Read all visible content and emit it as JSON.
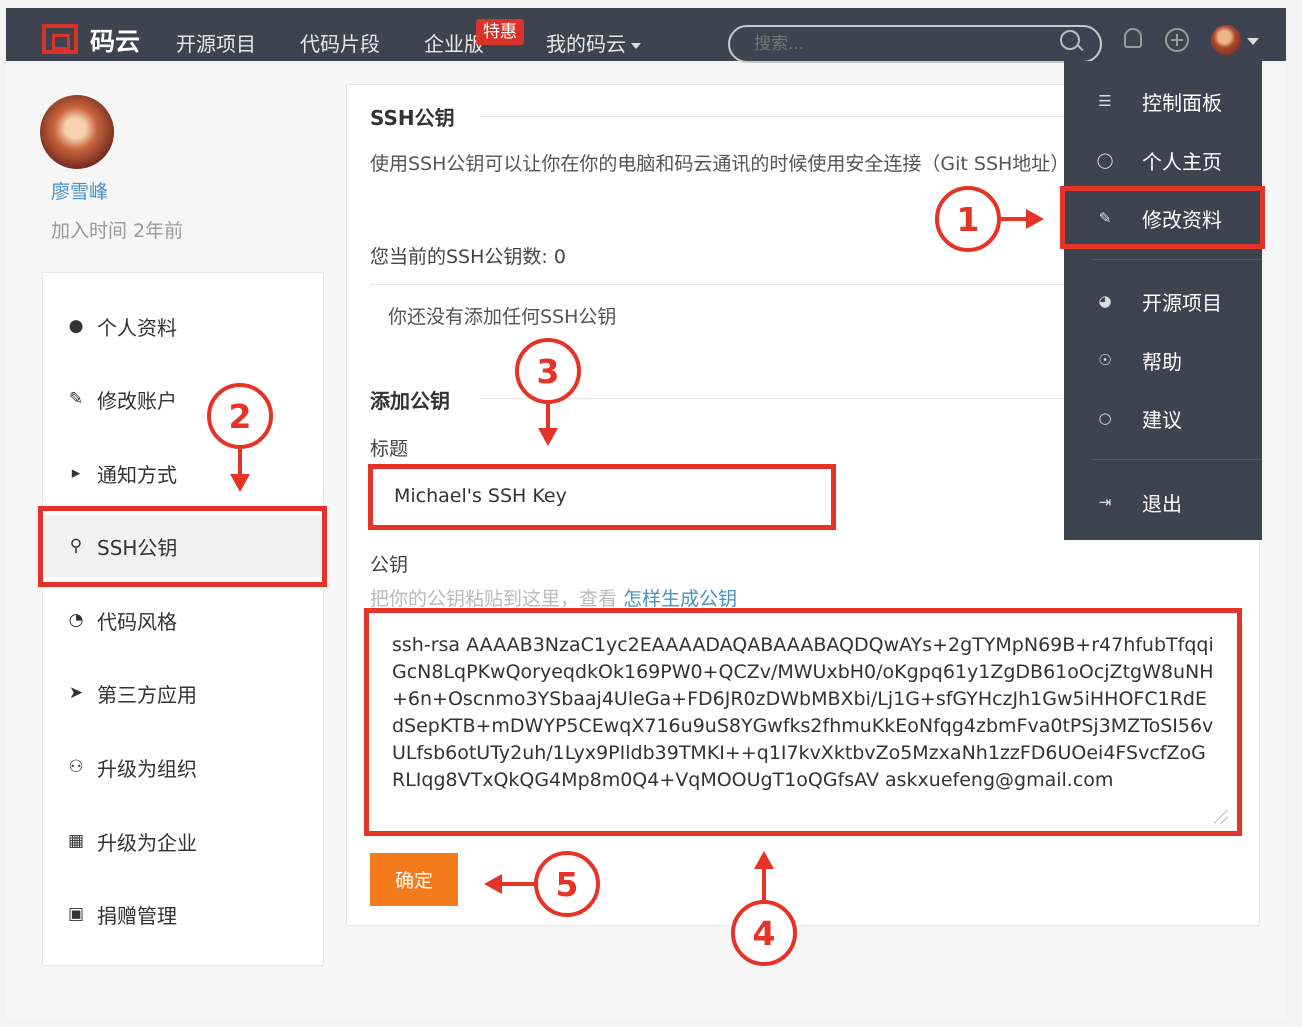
{
  "navbar": {
    "brand": "码云",
    "links": [
      "开源项目",
      "代码片段",
      "企业版",
      "我的码云"
    ],
    "hot_badge": "特惠",
    "search_placeholder": "搜索..."
  },
  "profile": {
    "name": "廖雪峰",
    "joined": "加入时间 2年前"
  },
  "sidebar": {
    "items": [
      {
        "label": "个人资料",
        "icon": "user-icon"
      },
      {
        "label": "修改账户",
        "icon": "pencil-icon"
      },
      {
        "label": "通知方式",
        "icon": "volume-icon"
      },
      {
        "label": "SSH公钥",
        "icon": "key-icon"
      },
      {
        "label": "代码风格",
        "icon": "dashboard-icon"
      },
      {
        "label": "第三方应用",
        "icon": "rocket-icon"
      },
      {
        "label": "升级为组织",
        "icon": "group-icon"
      },
      {
        "label": "升级为企业",
        "icon": "building-icon"
      },
      {
        "label": "捐赠管理",
        "icon": "gift-icon"
      }
    ]
  },
  "ssh": {
    "section_title": "SSH公钥",
    "description": "使用SSH公钥可以让你在你的电脑和码云通讯的时候使用安全连接（Git SSH地址）",
    "count_text": "您当前的SSH公钥数: 0",
    "empty_text": "你还没有添加任何SSH公钥"
  },
  "add_key": {
    "section_title": "添加公钥",
    "title_label": "标题",
    "title_value": "Michael's SSH Key",
    "key_label": "公钥",
    "hint_prefix": "把你的公钥粘贴到这里，查看",
    "hint_link": "怎样生成公钥",
    "key_value": "ssh-rsa AAAAB3NzaC1yc2EAAAADAQABAAABAQDQwAYs+2gTYMpN69B+r47hfubTfqqiGcN8LqPKwQoryeqdkOk169PW0+QCZv/MWUxbH0/oKgpq61y1ZgDB61oOcjZtgW8uNH+6n+Oscnmo3YSbaaj4UleGa+FD6JR0zDWbMBXbi/Lj1G+sfGYHczJh1Gw5iHHOFC1RdEdSepKTB+mDWYP5CEwqX716u9uS8YGwfks2fhmuKkEoNfqg4zbmFva0tPSj3MZToSI56vULfsb6otUTy2uh/1Lyx9PIldb39TMKI++q1I7kvXktbvZo5MzxaNh1zzFD6UOei4FSvcfZoGRLIqg8VTxQkQG4Mp8m0Q4+VqMOOUgT1oQGfsAV askxuefeng@gmail.com",
    "submit_label": "确定"
  },
  "dropdown": {
    "items": [
      {
        "label": "控制面板",
        "icon": "dashboard-icon"
      },
      {
        "label": "个人主页",
        "icon": "user-icon"
      },
      {
        "label": "修改资料",
        "icon": "edit-icon"
      },
      {
        "label": "开源项目",
        "icon": "compass-icon"
      },
      {
        "label": "帮助",
        "icon": "help-icon"
      },
      {
        "label": "建议",
        "icon": "comment-icon"
      },
      {
        "label": "退出",
        "icon": "logout-icon"
      }
    ]
  },
  "annotations": [
    "1",
    "2",
    "3",
    "4",
    "5"
  ],
  "colors": {
    "navbar": "#3d4450",
    "highlight": "#e53327",
    "primary_button": "#f37b1d",
    "link": "#4a90c8"
  }
}
